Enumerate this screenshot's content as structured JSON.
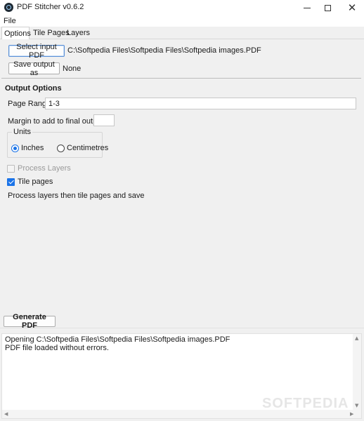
{
  "window": {
    "title": "PDF Stitcher v0.6.2",
    "icon": "app-icon"
  },
  "menu": {
    "file": "File"
  },
  "tabs": [
    {
      "label": "Options",
      "active": true
    },
    {
      "label": "Tile Pages",
      "active": false
    },
    {
      "label": "Layers",
      "active": false
    }
  ],
  "options": {
    "select_input_label": "Select input PDF",
    "input_path": "C:\\Softpedia Files\\Softpedia Files\\Softpedia images.PDF",
    "save_output_label": "Save output as",
    "output_value": "None",
    "section_title": "Output Options",
    "page_range_label": "Page Range:",
    "page_range_value": "1-3",
    "margin_label": "Margin to add to final output:",
    "margin_value": "",
    "units": {
      "title": "Units",
      "options": [
        {
          "label": "Inches",
          "selected": true
        },
        {
          "label": "Centimetres",
          "selected": false
        }
      ]
    },
    "process_layers": {
      "label": "Process Layers",
      "checked": false,
      "enabled": false
    },
    "tile_pages": {
      "label": "Tile pages",
      "checked": true,
      "enabled": true
    },
    "info": "Process layers then tile pages and save"
  },
  "generate_label": "Generate PDF",
  "log": [
    "Opening C:\\Softpedia Files\\Softpedia Files\\Softpedia images.PDF",
    "PDF file loaded without errors."
  ],
  "watermark": "SOFTPEDIA",
  "colors": {
    "accent": "#1a73e8",
    "background": "#f0f0f0"
  }
}
